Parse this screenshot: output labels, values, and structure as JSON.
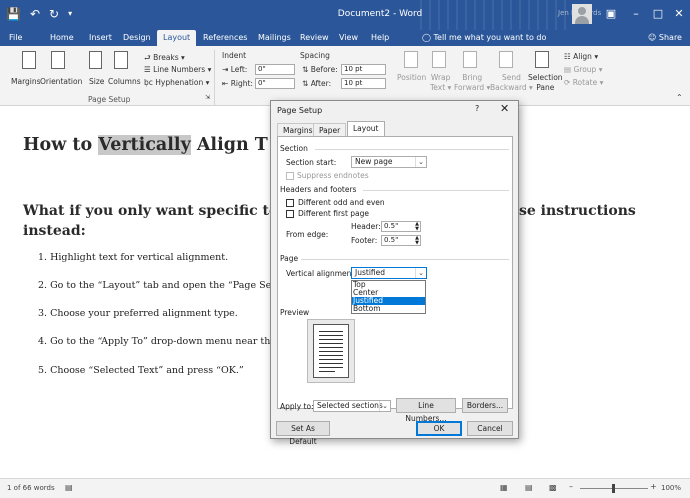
{
  "titlebar": {
    "save_icon": "save-icon",
    "undo_icon": "undo-icon",
    "redo_icon": "redo-icon",
    "customize_icon": "customize-qat-icon",
    "doc_title": "Document2 - Word",
    "account_name": "Jen Richards",
    "controls": {
      "ribbon_display": "ribbon-display-icon",
      "minimize": "–",
      "maximize": "□",
      "close": "✕"
    }
  },
  "tabs": [
    "File",
    "Home",
    "Insert",
    "Design",
    "Layout",
    "References",
    "Mailings",
    "Review",
    "View",
    "Help"
  ],
  "active_tab": "Layout",
  "tell_me": "Tell me what you want to do",
  "share": "Share",
  "ribbon": {
    "page_setup": {
      "margins": "Margins",
      "orientation": "Orientation",
      "size": "Size",
      "columns": "Columns",
      "breaks": "Breaks",
      "line_numbers": "Line Numbers",
      "hyphenation": "Hyphenation",
      "group_title": "Page Setup"
    },
    "indent": {
      "title": "Indent",
      "left_label": "Left:",
      "left_value": "0\"",
      "right_label": "Right:",
      "right_value": "0\""
    },
    "spacing": {
      "title": "Spacing",
      "before_label": "Before:",
      "before_value": "10 pt",
      "after_label": "After:",
      "after_value": "10 pt"
    },
    "arrange": {
      "position": "Position",
      "wrap_text": [
        "Wrap",
        "Text"
      ],
      "bring_forward": [
        "Bring",
        "Forward"
      ],
      "send_backward": [
        "Send",
        "Backward"
      ],
      "selection_pane": [
        "Selection",
        "Pane"
      ],
      "align": "Align",
      "group": "Group",
      "rotate": "Rotate"
    }
  },
  "document": {
    "h1_before": "How to ",
    "h1_highlight": "Vertically",
    "h1_after": " Align T",
    "h2_line1_left": "What if you only want specific te",
    "h2_line1_right": "se instructions",
    "h2_line2": "instead:",
    "list": [
      "1.  Highlight text for vertical alignment.",
      "2.  Go to the “Layout” tab and open the “Page Set",
      "3.  Choose your preferred alignment type.",
      "4.  Go to the “Apply To” drop-down menu near th",
      "5.  Choose “Selected Text” and press “OK.”"
    ]
  },
  "dialog": {
    "title": "Page Setup",
    "help": "?",
    "close": "✕",
    "tabs": [
      "Margins",
      "Paper",
      "Layout"
    ],
    "active_tab": "Layout",
    "section_header": "Section",
    "section_start_label": "Section start:",
    "section_start_value": "New page",
    "suppress_endnotes": "Suppress endnotes",
    "headers_footers_header": "Headers and footers",
    "diff_odd_even": "Different odd and even",
    "diff_first_page": "Different first page",
    "from_edge_label": "From edge:",
    "header_label": "Header:",
    "header_value": "0.5\"",
    "footer_label": "Footer:",
    "footer_value": "0.5\"",
    "page_header": "Page",
    "vertical_alignment_label": "Vertical alignment:",
    "vertical_alignment_value": "Justified",
    "dropdown_options": [
      "Top",
      "Center",
      "Justified",
      "Bottom"
    ],
    "preview_header": "Preview",
    "apply_to_label": "Apply to:",
    "apply_to_value": "Selected sections",
    "line_numbers_button": "Line Numbers...",
    "borders_button": "Borders...",
    "set_default_button": "Set As Default",
    "ok_button": "OK",
    "cancel_button": "Cancel"
  },
  "statusbar": {
    "word_count": "1 of 66 words",
    "proofing_icon": "proofing-icon",
    "zoom_minus": "–",
    "zoom_plus": "+",
    "zoom": "100%"
  }
}
